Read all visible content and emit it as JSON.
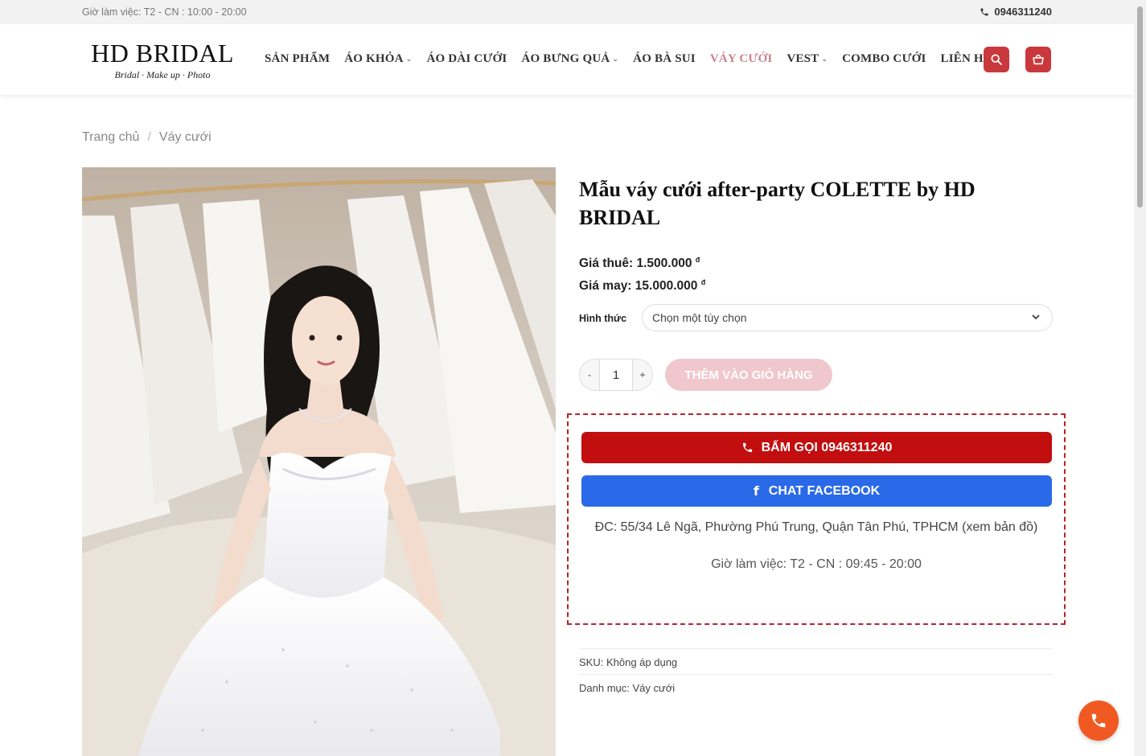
{
  "topbar": {
    "hours": "Giờ làm việc: T2 - CN : 10:00 - 20:00",
    "phone": "0946311240"
  },
  "header": {
    "logo": {
      "brand": "HD BRIDAL",
      "tagline": "Bridal · Make up · Photo"
    },
    "nav": [
      {
        "label": "SẢN PHẨM",
        "dropdown": false,
        "active": false
      },
      {
        "label": "ÁO KHỎA",
        "dropdown": true,
        "active": false
      },
      {
        "label": "ÁO DÀI CƯỚI",
        "dropdown": false,
        "active": false
      },
      {
        "label": "ÁO BƯNG QUẢ",
        "dropdown": true,
        "active": false
      },
      {
        "label": "ÁO BÀ SUI",
        "dropdown": false,
        "active": false
      },
      {
        "label": "VÁY CƯỚI",
        "dropdown": false,
        "active": true
      },
      {
        "label": "VEST",
        "dropdown": true,
        "active": false
      },
      {
        "label": "COMBO CƯỚI",
        "dropdown": false,
        "active": false
      },
      {
        "label": "LIÊN HỆ",
        "dropdown": false,
        "active": false
      }
    ],
    "search_icon": "search-icon",
    "cart_icon": "basket-icon"
  },
  "breadcrumb": {
    "home": "Trang chủ",
    "separator": "/",
    "current": "Váy cưới"
  },
  "product": {
    "title": "Mẫu váy cưới after-party COLETTE by HD BRIDAL",
    "rent_label": "Giá thuê:",
    "rent_price": "1.500.000",
    "sew_label": "Giá may:",
    "sew_price": "15.000.000",
    "currency": "đ",
    "variant_label": "Hình thức",
    "variant_placeholder": "Chọn một tùy chọn",
    "qty_minus": "-",
    "qty_value": "1",
    "qty_plus": "+",
    "add_to_cart": "THÊM VÀO GIỎ HÀNG"
  },
  "contact": {
    "call_label": "BẤM GỌI 0946311240",
    "facebook_label": "CHAT FACEBOOK",
    "address": "ĐC: 55/34 Lê Ngã, Phường Phú Trung, Quận Tân Phú, TPHCM (xem bản đồ)",
    "hours": "Giờ làm việc: T2 - CN : 09:45 - 20:00"
  },
  "meta": {
    "sku_label": "SKU:",
    "sku_value": "Không áp dụng",
    "category_label": "Danh mục:",
    "category_value": "Váy cưới"
  },
  "colors": {
    "accent_red": "#c20e0e",
    "facebook_blue": "#2a6ae8",
    "active_nav": "#c9838f",
    "fab_orange": "#f05a22"
  }
}
